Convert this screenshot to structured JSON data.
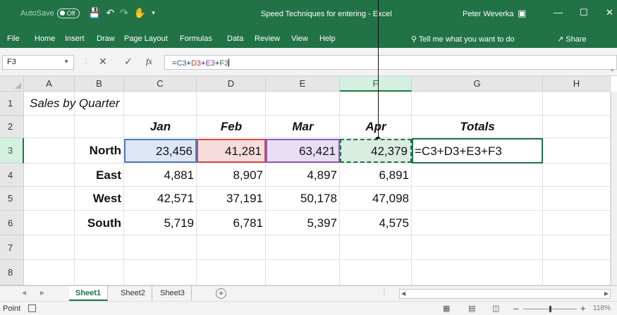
{
  "titlebar": {
    "autosave_label": "AutoSave",
    "autosave_state": "Off",
    "title": "Speed Techniques for entering - Excel",
    "user": "Peter Weverka",
    "colors": {
      "accent": "#217346"
    }
  },
  "menu": {
    "items": [
      "File",
      "Home",
      "Insert",
      "Draw",
      "Page Layout",
      "Formulas",
      "Data",
      "Review",
      "View",
      "Help"
    ],
    "tell_me": "Tell me what you want to do",
    "share": "Share"
  },
  "formula_bar": {
    "name_box": "F3",
    "fx": "fx",
    "formula_parts": [
      "=",
      "C3",
      "+",
      "D3",
      "+",
      "E3",
      "+",
      "F3"
    ]
  },
  "grid": {
    "columns": [
      "A",
      "B",
      "C",
      "D",
      "E",
      "F",
      "G",
      "H"
    ],
    "rows": [
      "1",
      "2",
      "3",
      "4",
      "5",
      "6",
      "7",
      "8"
    ],
    "title": "Sales by Quarter",
    "headers": [
      "Jan",
      "Feb",
      "Mar",
      "Apr",
      "Totals"
    ],
    "data": [
      {
        "region": "North",
        "values": [
          "23,456",
          "41,281",
          "63,421",
          "42,379"
        ],
        "total": "=C3+D3+E3+F3"
      },
      {
        "region": "East",
        "values": [
          "4,881",
          "8,907",
          "4,897",
          "6,891"
        ],
        "total": ""
      },
      {
        "region": "West",
        "values": [
          "42,571",
          "37,191",
          "50,178",
          "47,098"
        ],
        "total": ""
      },
      {
        "region": "South",
        "values": [
          "5,719",
          "6,781",
          "5,397",
          "4,575"
        ],
        "total": ""
      }
    ]
  },
  "sheets": [
    "Sheet1",
    "Sheet2",
    "Sheet3"
  ],
  "status": {
    "mode": "Point",
    "zoom": "118%"
  }
}
